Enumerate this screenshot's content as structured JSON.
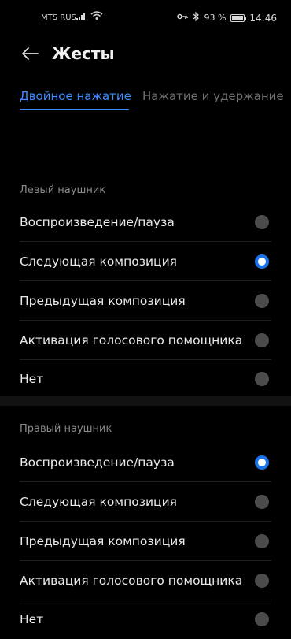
{
  "status_bar": {
    "carrier": "MTS RUS",
    "battery": "93 %",
    "time": "14:46"
  },
  "header": {
    "back_icon": "arrow-left-icon",
    "title": "Жесты"
  },
  "tabs": [
    {
      "label": "Двойное нажатие",
      "active": true
    },
    {
      "label": "Нажатие и удержание",
      "active": false
    }
  ],
  "left": {
    "title": "Левый наушник",
    "options": [
      {
        "label": "Воспроизведение/пауза",
        "selected": false
      },
      {
        "label": "Следующая композиция",
        "selected": true
      },
      {
        "label": "Предыдущая композиция",
        "selected": false
      },
      {
        "label": "Активация голосового помощника",
        "selected": false
      },
      {
        "label": "Нет",
        "selected": false
      }
    ]
  },
  "right": {
    "title": "Правый наушник",
    "options": [
      {
        "label": "Воспроизведение/пауза",
        "selected": true
      },
      {
        "label": "Следующая композиция",
        "selected": false
      },
      {
        "label": "Предыдущая композиция",
        "selected": false
      },
      {
        "label": "Активация голосового помощника",
        "selected": false
      },
      {
        "label": "Нет",
        "selected": false
      }
    ]
  },
  "colors": {
    "accent": "#3f8bfd",
    "radio_on": "#1a73e8",
    "radio_off": "#4b4b4b",
    "background": "#000000"
  }
}
